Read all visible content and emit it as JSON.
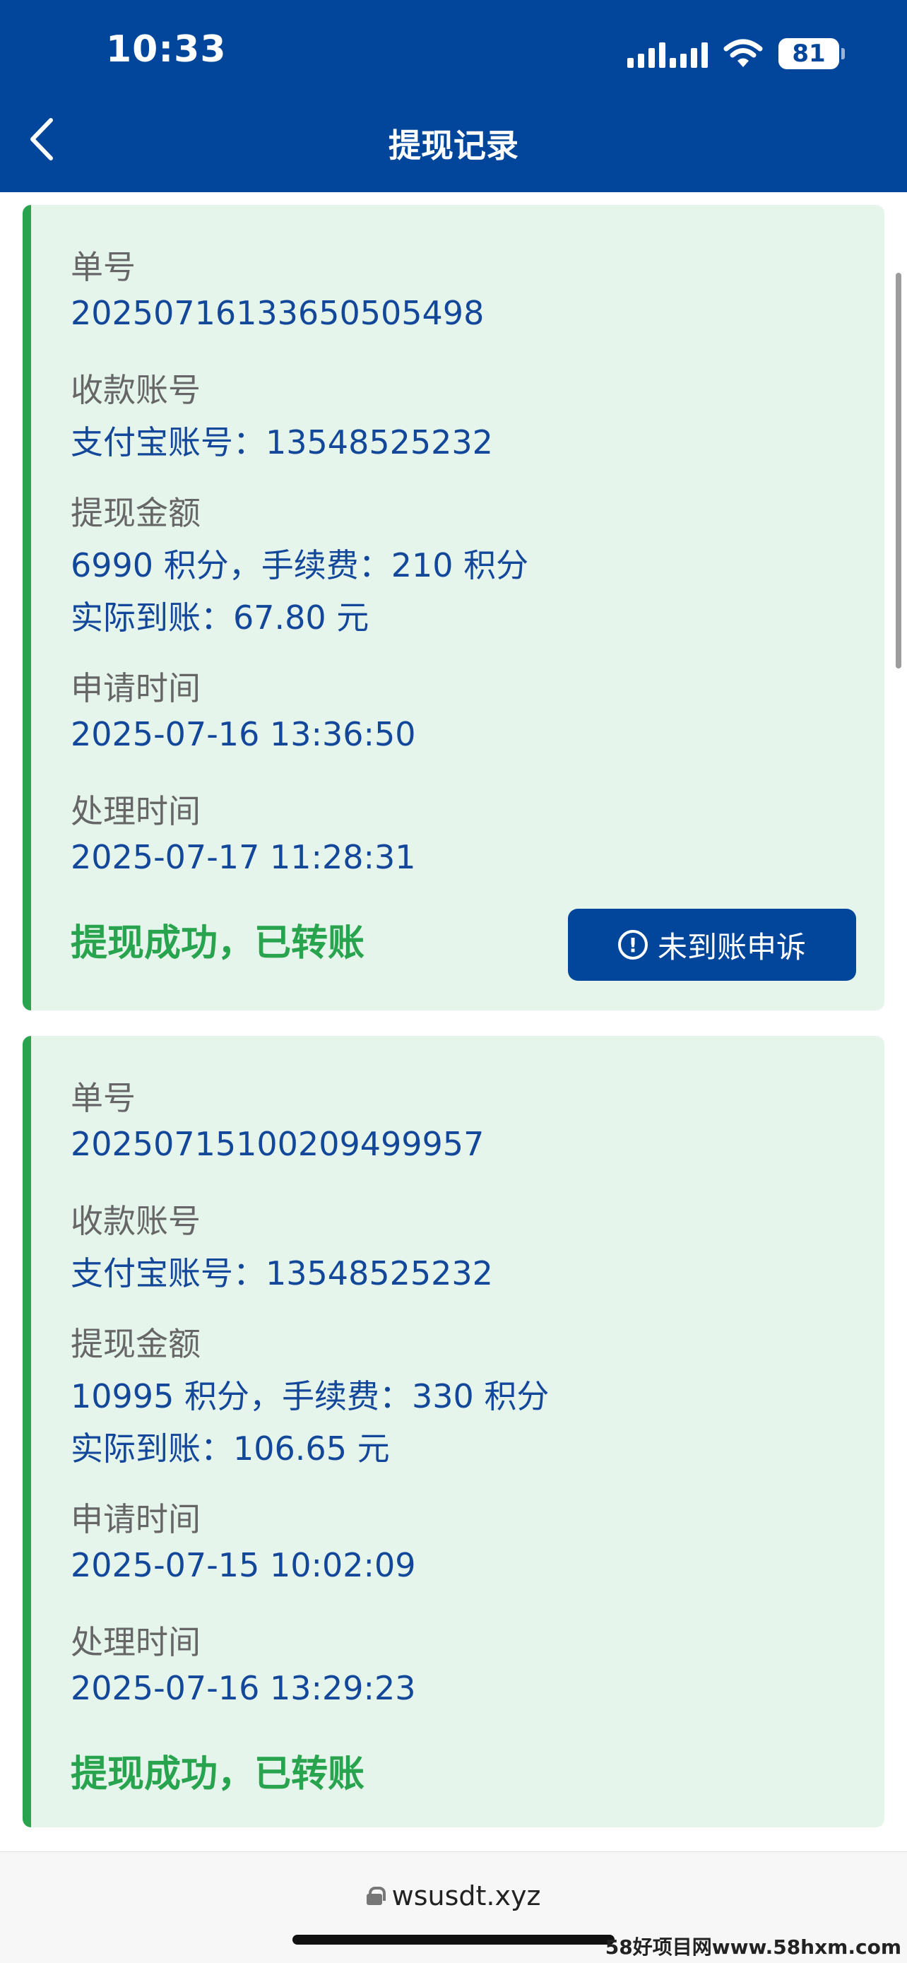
{
  "status_bar": {
    "time": "10:33",
    "battery": "81"
  },
  "header": {
    "title": "提现记录"
  },
  "records": [
    {
      "order_label": "单号",
      "order_value": "20250716133650505498",
      "account_label": "收款账号",
      "account_value": "支付宝账号：13548525232",
      "amount_label": "提现金额",
      "amount_value": "6990 积分，手续费：210 积分",
      "actual_value": "实际到账：67.80 元",
      "apply_label": "申请时间",
      "apply_value": "2025-07-16 13:36:50",
      "process_label": "处理时间",
      "process_value": "2025-07-17 11:28:31",
      "status": "提现成功，已转账",
      "appeal_button": "未到账申诉"
    },
    {
      "order_label": "单号",
      "order_value": "20250715100209499957",
      "account_label": "收款账号",
      "account_value": "支付宝账号：13548525232",
      "amount_label": "提现金额",
      "amount_value": "10995 积分，手续费：330 积分",
      "actual_value": "实际到账：106.65 元",
      "apply_label": "申请时间",
      "apply_value": "2025-07-15 10:02:09",
      "process_label": "处理时间",
      "process_value": "2025-07-16 13:29:23",
      "status": "提现成功，已转账"
    }
  ],
  "browser": {
    "url": "wsusdt.xyz"
  },
  "watermark": "58好项目网www.58hxm.com",
  "colors": {
    "header_bg": "#01469a",
    "card_bg": "#e6f5ec",
    "accent_green": "#29a44e",
    "value_blue": "#13479a"
  }
}
